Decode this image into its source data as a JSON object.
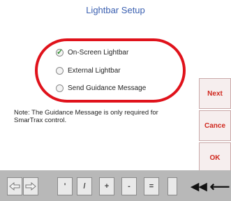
{
  "title": "Lightbar Setup",
  "options": [
    {
      "label": "On-Screen Lightbar",
      "selected": true
    },
    {
      "label": "External Lightbar",
      "selected": false
    },
    {
      "label": "Send Guidance Message",
      "selected": false
    }
  ],
  "note": "Note: The Guidance Message is only required for SmarTrax control.",
  "buttons": {
    "next": "Next",
    "cancel": "Cance",
    "ok": "OK"
  },
  "keypad": {
    "keys": [
      "'",
      "/",
      "+",
      "-",
      "="
    ],
    "back_all": "◀◀",
    "backspace": "⟵"
  },
  "colors": {
    "title": "#3a5fb0",
    "highlight": "#e0121b",
    "button_text": "#d0281e"
  }
}
